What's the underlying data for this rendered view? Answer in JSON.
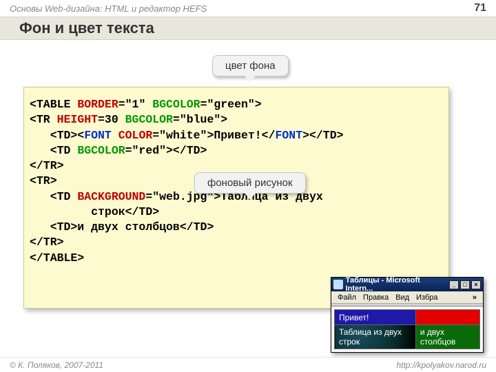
{
  "header": {
    "breadcrumb": "Основы Web-дизайна: HTML и редактор HEFS",
    "page_number": "71"
  },
  "title": "Фон и цвет текста",
  "callouts": {
    "c1": "цвет фона",
    "c2": "фоновый рисунок"
  },
  "code": {
    "l1_a": "<TABLE ",
    "l1_b": "BORDER",
    "l1_c": "=\"1\" ",
    "l1_d": "BGCOLOR",
    "l1_e": "=\"green\">",
    "l2_a": "<TR ",
    "l2_b": "HEIGHT",
    "l2_c": "=30 ",
    "l2_d": "BGCOLOR",
    "l2_e": "=\"blue\">",
    "l3_a": "   <TD><",
    "l3_b": "FONT",
    "l3_c": " ",
    "l3_d": "COLOR",
    "l3_e": "=\"white\">Привет!</",
    "l3_f": "FONT",
    "l3_g": "></TD>",
    "l4_a": "   <TD ",
    "l4_b": "BGCOLOR",
    "l4_c": "=\"red\"></TD>",
    "l5": "</TR>",
    "l6": "<TR>",
    "l7_a": "   <TD ",
    "l7_b": "BACKGROUND",
    "l7_c": "=\"web.jpg\">Таблица из двух",
    "l8": "         строк</TD>",
    "l9": "   <TD>и двух столбцов</TD>",
    "l10": "</TR>",
    "l11": "</TABLE>"
  },
  "browser": {
    "title": "Таблицы - Microsoft Intern...",
    "menu": {
      "file": "Файл",
      "edit": "Правка",
      "view": "Вид",
      "fav": "Избра",
      "chev": "»"
    },
    "btn_min": "_",
    "btn_max": "□",
    "btn_close": "×",
    "cells": {
      "c1": "Привет!",
      "c2": "",
      "c3": "Таблица из двух строк",
      "c4": "и двух столбцов"
    }
  },
  "footer": {
    "copyright": "© К. Поляков, 2007-2011",
    "url": "http://kpolyakov.narod.ru"
  }
}
